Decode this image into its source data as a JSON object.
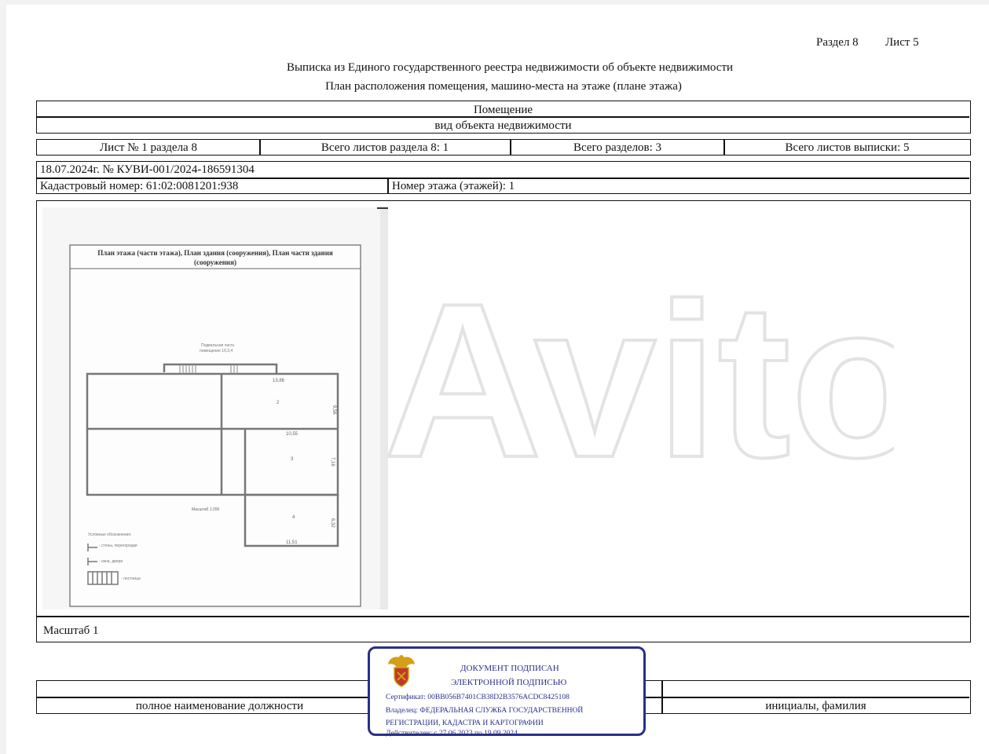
{
  "header": {
    "section": "Раздел 8",
    "sheet": "Лист 5"
  },
  "titles": {
    "line1": "Выписка из Единого государственного реестра недвижимости об объекте недвижимости",
    "line2": "План расположения помещения, машино-места на этаже (плане этажа)"
  },
  "object": {
    "name": "Помещение",
    "kind": "вид объекта недвижимости"
  },
  "sheets_row": [
    "Лист № 1 раздела 8",
    "Всего листов раздела 8: 1",
    "Всего разделов: 3",
    "Всего листов выписки: 5"
  ],
  "record": {
    "date_number": "18.07.2024г. № КУВИ-001/2024-186591304",
    "cadastral": "Кадастровый номер: 61:02:0081201:938",
    "floor": "Номер этажа (этажей): 1"
  },
  "plan": {
    "title_line1": "План этажа (части этажа), План здания (сооружения), План части здания",
    "title_line2": "(сооружения)",
    "note_line1": "Подвальная часть",
    "note_line2": "помещение 1б,3,4",
    "rooms": [
      "2",
      "3",
      "4"
    ],
    "dims": [
      "13,86",
      "9,56",
      "10,55",
      "7,16",
      "6,32",
      "11,51"
    ],
    "scale_note": "Масштаб 1:200",
    "legend_title": "Условные обозначения:",
    "legend_items": [
      "- стены, перегородки",
      "- окна, двери",
      "- лестница"
    ]
  },
  "scale": "Масштаб 1",
  "signature": {
    "position": "полное наименование должности",
    "name": "инициалы, фамилия"
  },
  "stamp": {
    "line1": "ДОКУМЕНТ ПОДПИСАН",
    "line2": "ЭЛЕКТРОННОЙ ПОДПИСЬЮ",
    "certificate": "Сертификат: 00BB056B7401CB38D2B3576ACDC8425108",
    "owner1": "Владелец: ФЕДЕРАЛЬНАЯ СЛУЖБА ГОСУДАРСТВЕННОЙ",
    "owner2": "РЕГИСТРАЦИИ, КАДАСТРА И КАРТОГРАФИИ",
    "valid": "Действителен: с 27.06.2023 по 19.09.2024"
  },
  "watermark": {
    "text": "Avito"
  },
  "colors": {
    "stamp": "#2a2f8a",
    "emblem_red": "#c0392b",
    "emblem_gold": "#d4a017"
  }
}
